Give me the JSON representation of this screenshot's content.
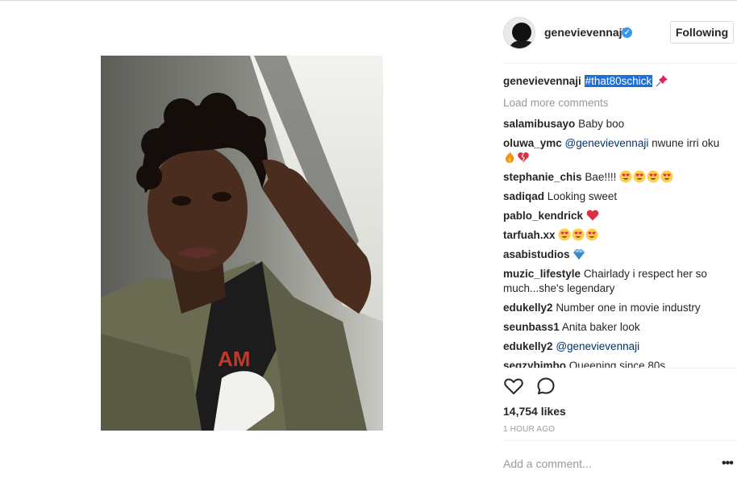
{
  "post": {
    "username": "genevievennaji",
    "follow_label": "Following",
    "caption_user": "genevievennaji",
    "caption_tag": "#that80schick",
    "load_more": "Load more comments",
    "likes": "14,754 likes",
    "time": "1 HOUR AGO",
    "add_comment_placeholder": "Add a comment...",
    "more_label": "•••"
  },
  "comments": [
    {
      "user": "salamibusayo",
      "text": "Baby boo"
    },
    {
      "user": "oluwa_ymc",
      "mention": "@genevievennaji",
      "text": "nwune irri oku",
      "emojis": [
        "fire-emoji",
        "broken-heart-emoji"
      ]
    },
    {
      "user": "stephanie_chis",
      "text": "Bae!!!!",
      "emojis": [
        "heart-eyes-emoji",
        "heart-eyes-emoji",
        "heart-eyes-emoji",
        "heart-eyes-emoji"
      ]
    },
    {
      "user": "sadiqad",
      "text": "Looking sweet"
    },
    {
      "user": "pablo_kendrick",
      "emojis": [
        "red-heart-emoji"
      ]
    },
    {
      "user": "tarfuah.xx",
      "emojis": [
        "heart-eyes-emoji",
        "heart-eyes-emoji",
        "heart-eyes-emoji"
      ]
    },
    {
      "user": "asabistudios",
      "emojis": [
        "gem-emoji"
      ]
    },
    {
      "user": "muzic_lifestyle",
      "text": "Chairlady i respect her so much...she's legendary"
    },
    {
      "user": "edukelly2",
      "text": "Number one in movie industry"
    },
    {
      "user": "seunbass1",
      "text": "Anita baker look"
    },
    {
      "user": "edukelly2",
      "mention": "@genevievennaji"
    },
    {
      "user": "segzybimbo",
      "text": "Queening since 80s"
    }
  ],
  "colors": {
    "accent": "#3897f0",
    "tag_highlight": "#1a6fd8",
    "mention": "#003569",
    "muted": "#999999"
  }
}
